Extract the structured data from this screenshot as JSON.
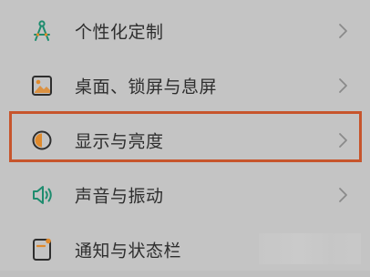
{
  "settings": {
    "items": [
      {
        "label": "个性化定制",
        "icon": "compass-icon",
        "has_chevron": true
      },
      {
        "label": "桌面、锁屏与息屏",
        "icon": "wallpaper-icon",
        "has_chevron": true
      },
      {
        "label": "显示与亮度",
        "icon": "brightness-icon",
        "has_chevron": true
      },
      {
        "label": "声音与振动",
        "icon": "speaker-icon",
        "has_chevron": true
      },
      {
        "label": "通知与状态栏",
        "icon": "notification-icon",
        "has_chevron": false
      }
    ]
  },
  "colors": {
    "background": "#c4c4c4",
    "text": "#2e2e2e",
    "icon_green": "#1e8c6e",
    "icon_orange": "#e08a2c",
    "highlight": "#c7552c",
    "chevron": "#8a8a8a"
  }
}
